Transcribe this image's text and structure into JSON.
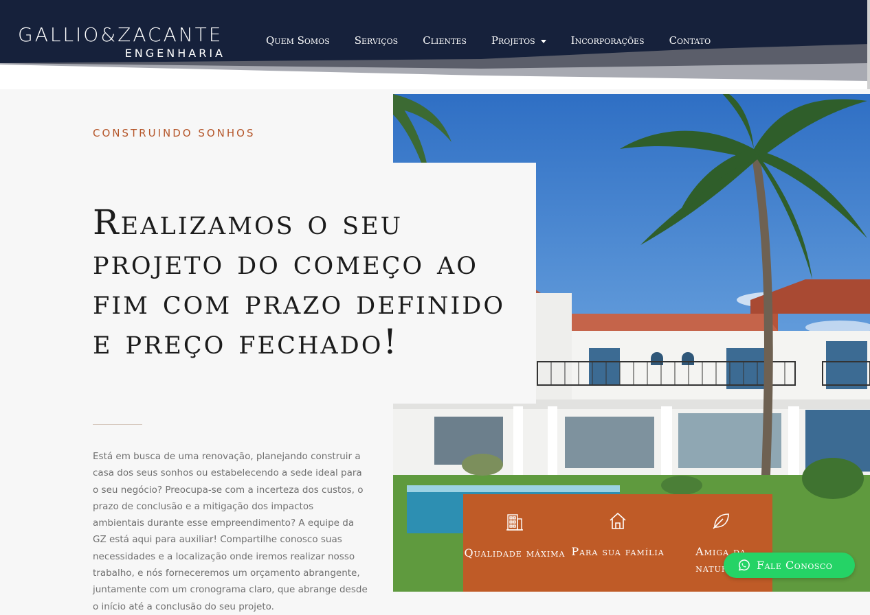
{
  "header": {
    "brand": "GALLIO&ZACANTE",
    "brand_sub": "ENGENHARIA",
    "nav": [
      {
        "label": "Quem Somos"
      },
      {
        "label": "Serviços"
      },
      {
        "label": "Clientes"
      },
      {
        "label": "Projetos"
      },
      {
        "label": "Incorporações"
      },
      {
        "label": "Contato"
      }
    ],
    "colors": {
      "navy": "#16213b",
      "accent": "#bf5b27"
    }
  },
  "hero": {
    "eyebrow": "CONSTRUINDO SONHOS",
    "headline": "Realizamos o seu projeto do começo ao fim com prazo definido e preço fechado!",
    "intro": "Está em busca de uma renovação, planejando construir a casa dos seus sonhos ou estabelecendo a sede ideal para o seu negócio? Preocupa-se com a incerteza dos custos, o prazo de conclusão e a mitigação dos impactos ambientais durante esse empreendimento? A equipe da GZ está aqui para auxiliar! Compartilhe conosco suas necessidades e a localização onde iremos realizar nosso trabalho, e nós forneceremos um orçamento abrangente, juntamente com um cronograma claro, que abrange desde o início até a conclusão do seu projeto."
  },
  "features": [
    {
      "icon": "building-icon",
      "label": "Qualidade máxima"
    },
    {
      "icon": "house-icon",
      "label": "Para sua família"
    },
    {
      "icon": "leaf-icon",
      "label": "Amiga da natureza"
    }
  ],
  "whatsapp": {
    "icon": "whatsapp-icon",
    "label": "Fale Conosco",
    "color": "#25d366"
  }
}
